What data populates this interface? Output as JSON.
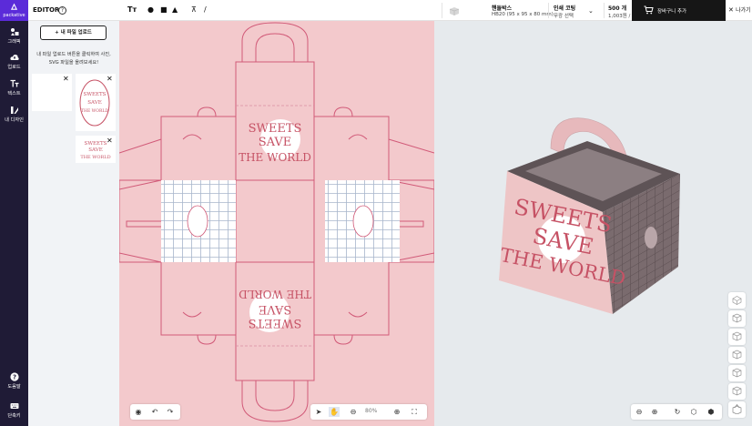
{
  "brand": {
    "name": "packative"
  },
  "rail": {
    "items": [
      {
        "label": "그래픽",
        "icon": "graphic-icon"
      },
      {
        "label": "업로드",
        "icon": "upload-cloud-icon"
      },
      {
        "label": "텍스트",
        "icon": "text-icon"
      },
      {
        "label": "내 디자인",
        "icon": "my-design-icon"
      }
    ],
    "bottom": [
      {
        "label": "도움말",
        "icon": "help-icon"
      },
      {
        "label": "단축키",
        "icon": "keyboard-icon"
      }
    ]
  },
  "topbar": {
    "title": "EDITOR",
    "help_glyph": "?",
    "tools": [
      "Tт",
      "●",
      "■",
      "▲",
      "⊼",
      "/"
    ],
    "product": {
      "title": "핸들박스",
      "sub": "HB20 (95 x 95 x 80 mm)"
    },
    "print": {
      "title": "인쇄 코팅",
      "sub": "무광 선택"
    },
    "quantity": {
      "title": "500 개",
      "sub": "1,003원 / 개당"
    },
    "cart_label": "장바구니 추가",
    "exit_label": "나가기"
  },
  "panel": {
    "upload_label": "내 파일 업로드",
    "hint_line1": "내 파일 업로드 버튼을 클릭하여 사진,",
    "hint_line2": "SVG 파일을 올려보세요!"
  },
  "design": {
    "line1": "SWEETS",
    "line2": "SAVE",
    "line3": "THE WORLD"
  },
  "canvas_controls": {
    "zoom": "80%"
  },
  "colors": {
    "brand": "#5b2bd9",
    "rail": "#1f1b36",
    "canvas_bg": "#f3c9cc",
    "box_pink": "#eec5c6",
    "accent_text": "#c65265"
  }
}
